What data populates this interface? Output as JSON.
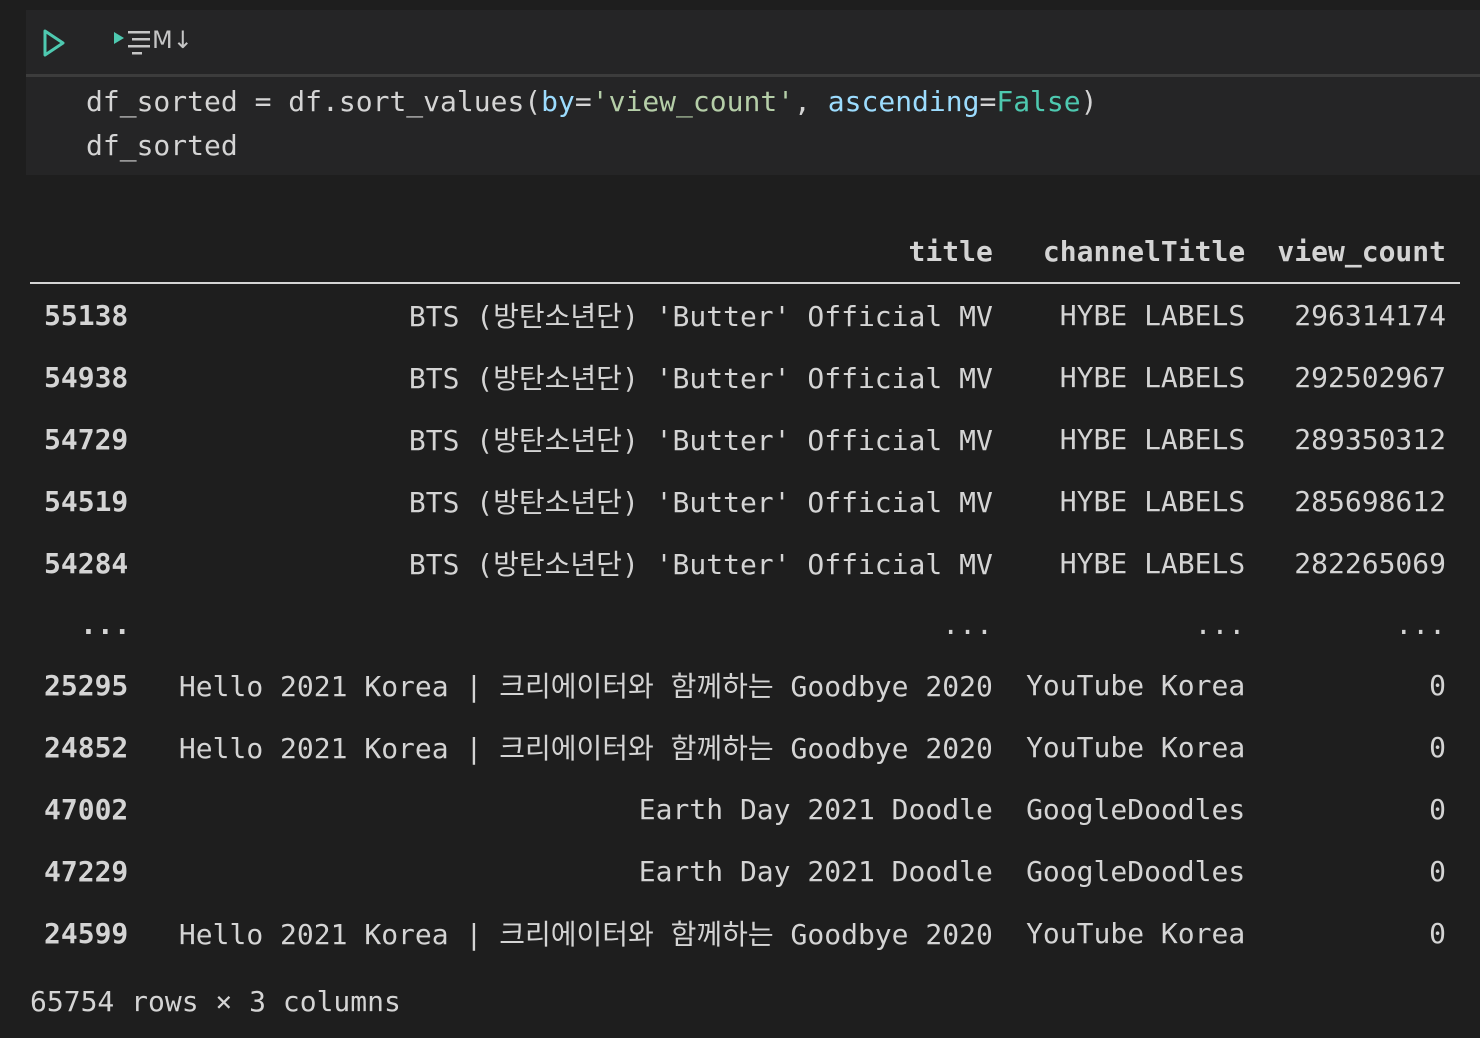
{
  "toolbar": {
    "run_icon": "run-cell-icon",
    "run_all_icon": "execute-above-icon",
    "markdown_label": "M↓"
  },
  "code": {
    "line1": {
      "var": "df_sorted",
      "eq": " = ",
      "call": "df.sort_values(",
      "p1": "by",
      "p1eq": "=",
      "p1val": "'view_count'",
      "sep": ", ",
      "p2": "ascending",
      "p2eq": "=",
      "p2val": "False",
      "close": ")"
    },
    "line2": "df_sorted"
  },
  "table": {
    "columns": [
      "",
      "title",
      "channelTitle",
      "view_count"
    ],
    "rows_top": [
      {
        "index": "55138",
        "title": "BTS (방탄소년단) 'Butter' Official MV",
        "channel": "HYBE LABELS",
        "views": "296314174"
      },
      {
        "index": "54938",
        "title": "BTS (방탄소년단) 'Butter' Official MV",
        "channel": "HYBE LABELS",
        "views": "292502967"
      },
      {
        "index": "54729",
        "title": "BTS (방탄소년단) 'Butter' Official MV",
        "channel": "HYBE LABELS",
        "views": "289350312"
      },
      {
        "index": "54519",
        "title": "BTS (방탄소년단) 'Butter' Official MV",
        "channel": "HYBE LABELS",
        "views": "285698612"
      },
      {
        "index": "54284",
        "title": "BTS (방탄소년단) 'Butter' Official MV",
        "channel": "HYBE LABELS",
        "views": "282265069"
      }
    ],
    "ellipsis": [
      "...",
      "...",
      "...",
      "..."
    ],
    "rows_bottom": [
      {
        "index": "25295",
        "title": "Hello 2021 Korea | 크리에이터와 함께하는 Goodbye 2020",
        "channel": "YouTube Korea",
        "views": "0"
      },
      {
        "index": "24852",
        "title": "Hello 2021 Korea | 크리에이터와 함께하는 Goodbye 2020",
        "channel": "YouTube Korea",
        "views": "0"
      },
      {
        "index": "47002",
        "title": "Earth Day 2021 Doodle",
        "channel": "GoogleDoodles",
        "views": "0"
      },
      {
        "index": "47229",
        "title": "Earth Day 2021 Doodle",
        "channel": "GoogleDoodles",
        "views": "0"
      },
      {
        "index": "24599",
        "title": "Hello 2021 Korea | 크리에이터와 함께하는 Goodbye 2020",
        "channel": "YouTube Korea",
        "views": "0"
      }
    ]
  },
  "footer": "65754 rows × 3 columns",
  "colors": {
    "background": "#1e1e1e",
    "run_icon": "#4ec9b0"
  }
}
